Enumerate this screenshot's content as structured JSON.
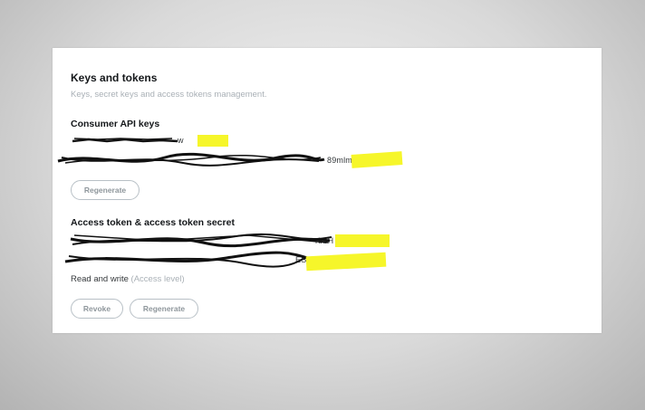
{
  "page": {
    "title": "Keys and tokens",
    "subtitle": "Keys, secret keys and access tokens management."
  },
  "consumer": {
    "heading": "Consumer API keys",
    "api_key_visible": "w",
    "api_secret_visible": "89mlm (",
    "regenerate_label": "Regenerate"
  },
  "access": {
    "heading": "Access token & access token secret",
    "token_visible": "rbbH",
    "secret_visible": "ESKrg",
    "level_label": "Read and write",
    "level_note": "(Access level)",
    "revoke_label": "Revoke",
    "regenerate_label": "Regenerate"
  },
  "colors": {
    "redaction_highlight": "#f6f62a",
    "scribble": "#111111"
  }
}
